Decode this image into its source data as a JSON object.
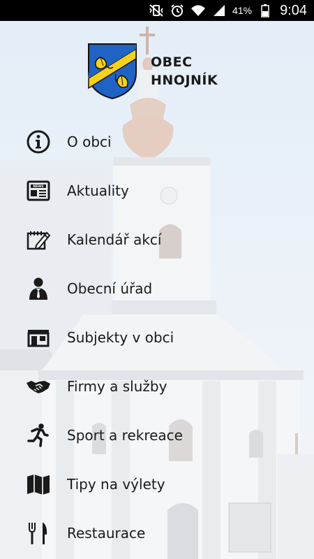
{
  "status_bar": {
    "battery_percent": "41%",
    "time": "9:04"
  },
  "brand": {
    "line1": "OBEC",
    "line2": "HNOJNÍK",
    "crest_colors": {
      "shield_blue": "#1f63c4",
      "gold": "#f6d21a",
      "outline": "#111111"
    }
  },
  "menu": {
    "items": [
      {
        "label": "O obci",
        "icon": "info-icon"
      },
      {
        "label": "Aktuality",
        "icon": "newspaper-icon"
      },
      {
        "label": "Kalendář akcí",
        "icon": "calendar-edit-icon"
      },
      {
        "label": "Obecní úřad",
        "icon": "official-person-icon"
      },
      {
        "label": "Subjekty v obci",
        "icon": "store-icon"
      },
      {
        "label": "Firmy a služby",
        "icon": "handshake-icon"
      },
      {
        "label": "Sport a rekreace",
        "icon": "running-person-icon"
      },
      {
        "label": "Tipy na výlety",
        "icon": "map-icon"
      },
      {
        "label": "Restaurace",
        "icon": "cutlery-icon"
      }
    ]
  },
  "colors": {
    "text": "#1a1a1a",
    "status_bar_bg": "#000000"
  }
}
